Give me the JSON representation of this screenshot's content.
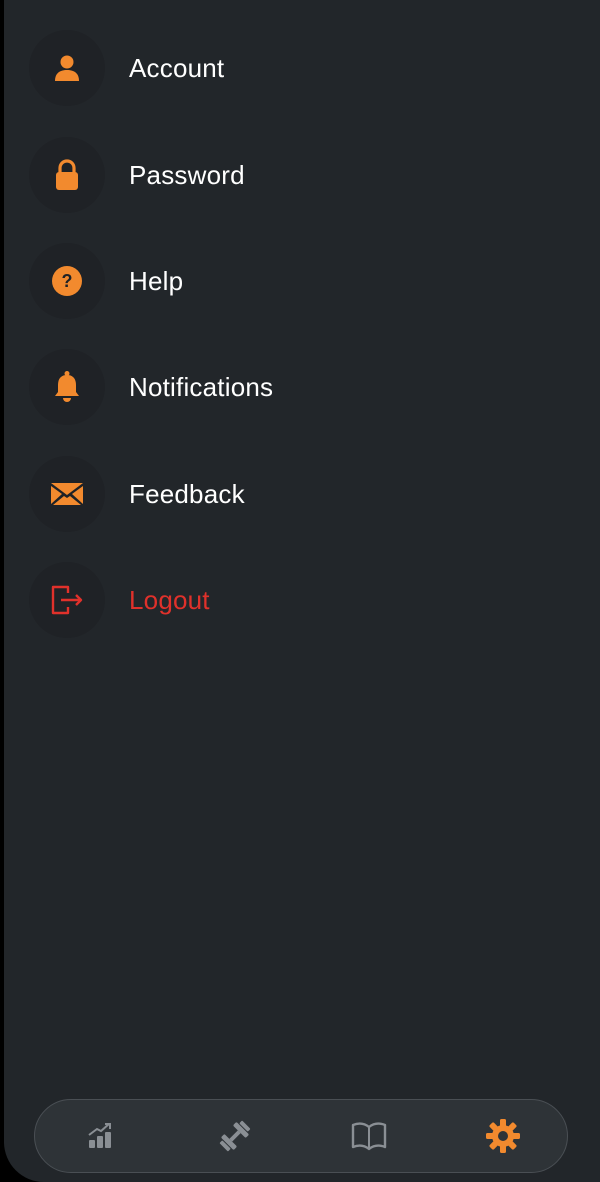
{
  "menu": {
    "items": [
      {
        "label": "Account",
        "icon": "person-icon"
      },
      {
        "label": "Password",
        "icon": "lock-icon"
      },
      {
        "label": "Help",
        "icon": "help-icon"
      },
      {
        "label": "Notifications",
        "icon": "bell-icon"
      },
      {
        "label": "Feedback",
        "icon": "envelope-icon"
      },
      {
        "label": "Logout",
        "icon": "logout-icon"
      }
    ]
  },
  "tabbar": {
    "tabs": [
      {
        "icon": "chart-icon",
        "active": false
      },
      {
        "icon": "dumbbell-icon",
        "active": false
      },
      {
        "icon": "book-icon",
        "active": false
      },
      {
        "icon": "gear-icon",
        "active": true
      }
    ]
  },
  "colors": {
    "accent": "#f28a2e",
    "danger": "#e0312b",
    "background": "#22262a",
    "icon_circle": "#1f2226",
    "tab_inactive": "#8a8f94"
  }
}
